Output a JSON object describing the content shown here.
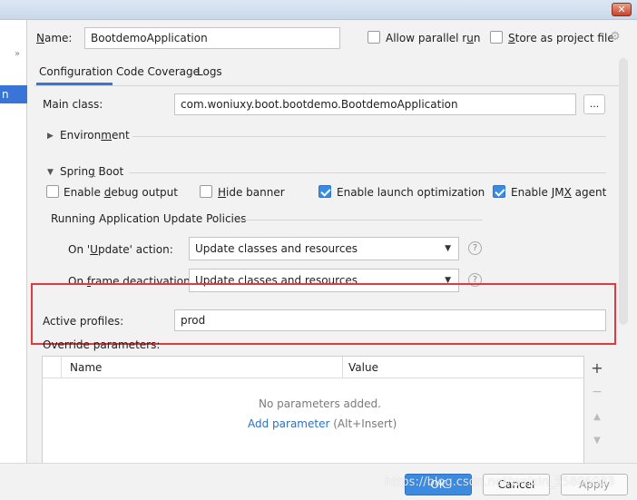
{
  "window": {
    "close_glyph": "✕"
  },
  "sidebar": {
    "expand_glyph": "»",
    "selected_fragment": "n"
  },
  "config": {
    "name_label_pre": "",
    "name_label_u": "N",
    "name_label_post": "ame:",
    "name_value": "BootdemoApplication",
    "allow_parallel_pre": "Allow parallel r",
    "allow_parallel_u": "u",
    "allow_parallel_post": "n",
    "allow_parallel_checked": false,
    "store_pre": "",
    "store_u": "S",
    "store_post": "tore as project file",
    "store_checked": false
  },
  "tabs": [
    {
      "label": "Configuration",
      "active": true
    },
    {
      "label": "Code Coverage",
      "active": false
    },
    {
      "label": "Logs",
      "active": false
    }
  ],
  "main_class": {
    "label": "Main class:",
    "value": "com.woniuxy.boot.bootdemo.BootdemoApplication",
    "browse": "..."
  },
  "environment": {
    "pre": "Environ",
    "u": "m",
    "post": "ent"
  },
  "spring_boot": {
    "title_pre": "Sprin",
    "title_u": "g",
    "title_post": " Boot",
    "options": [
      {
        "pre": "Enable ",
        "u": "d",
        "post": "ebug output",
        "checked": false
      },
      {
        "pre": "",
        "u": "H",
        "post": "ide banner",
        "checked": false
      },
      {
        "pre": "Enable launch optimization",
        "u": "",
        "post": "",
        "checked": true
      },
      {
        "pre": "Enable JM",
        "u": "X",
        "post": " agent",
        "checked": true
      }
    ]
  },
  "update_policies": {
    "title": "Running Application Update Policies",
    "on_update_pre": "On '",
    "on_update_u": "U",
    "on_update_post": "pdate' action:",
    "on_update_value": "Update classes and resources",
    "on_frame_pre": "On ",
    "on_frame_u": "f",
    "on_frame_post": "rame deactivation:",
    "on_frame_value": "Update classes and resources",
    "help_glyph": "?"
  },
  "active_profiles": {
    "label": "Active profiles:",
    "value": "prod"
  },
  "override": {
    "label": "Override parameters:",
    "columns": [
      "Name",
      "Value"
    ],
    "empty_text": "No parameters added.",
    "add_link": "Add parameter",
    "add_hint": " (Alt+Insert)",
    "tool_add": "+",
    "tool_remove": "−",
    "tool_up": "▲",
    "tool_down": "▼"
  },
  "buttons": {
    "ok": "OK",
    "cancel": "Cancel",
    "apply": "Apply"
  },
  "watermark": "https://blog.csdn.net/weixin_55806033"
}
